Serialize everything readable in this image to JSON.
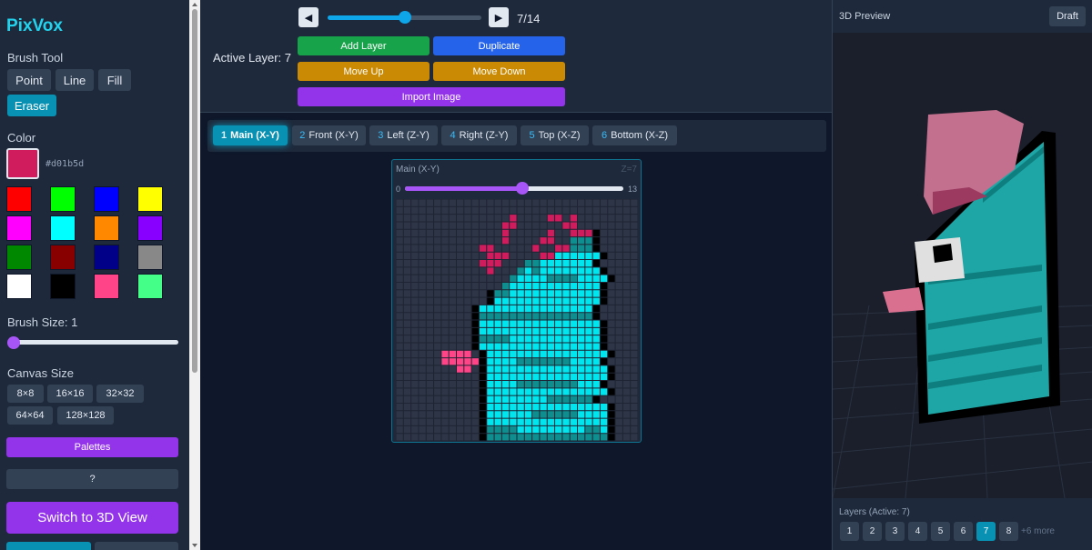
{
  "app": {
    "name": "PixVox"
  },
  "sidebar": {
    "brush_tool_label": "Brush Tool",
    "tools": [
      "Point",
      "Line",
      "Fill",
      "Eraser"
    ],
    "active_tool": "Eraser",
    "color_label": "Color",
    "current_color": "#d01b5d",
    "palette": [
      "#ff0000",
      "#00ff00",
      "#0000ff",
      "#ffff00",
      "#ff00ff",
      "#00ffff",
      "#ff8800",
      "#8800ff",
      "#008800",
      "#880000",
      "#000088",
      "#888888",
      "#ffffff",
      "#000000",
      "#ff4488",
      "#44ff88"
    ],
    "brush_size_label": "Brush Size: 1",
    "brush_size": 1,
    "canvas_size_label": "Canvas Size",
    "canvas_sizes": [
      "8×8",
      "16×16",
      "32×32",
      "64×64",
      "128×128"
    ],
    "palettes_button": "Palettes",
    "help_button": "?",
    "switch_button": "Switch to 3D View"
  },
  "toolbar": {
    "active_layer_label": "Active Layer: 7",
    "prev_icon": "◀",
    "next_icon": "▶",
    "layer_counter": "7/14",
    "layer_slider_value": 7,
    "layer_slider_max": 14,
    "buttons": {
      "add": "Add Layer",
      "duplicate": "Duplicate",
      "up": "Move Up",
      "down": "Move Down",
      "import": "Import Image"
    },
    "colors": {
      "add": "#16a34a",
      "duplicate": "#2563eb",
      "move": "#ca8a04",
      "import": "#9333ea"
    }
  },
  "views": [
    {
      "num": "1",
      "label": "Main (X-Y)",
      "active": true
    },
    {
      "num": "2",
      "label": "Front (X-Y)"
    },
    {
      "num": "3",
      "label": "Left (Z-Y)"
    },
    {
      "num": "4",
      "label": "Right (Z-Y)"
    },
    {
      "num": "5",
      "label": "Top (X-Z)"
    },
    {
      "num": "6",
      "label": "Bottom (X-Z)"
    }
  ],
  "editor": {
    "title": "Main (X-Y)",
    "z_label": "Z=7",
    "slider_min": "0",
    "slider_max": "13",
    "slider_value": 7,
    "grid_size": 32,
    "legend": {
      ".": "empty",
      "p": "pink",
      "t": "teal",
      "c": "cyan",
      "k": "black",
      "r": "rose"
    },
    "colors": {
      "p": "#d01b5d",
      "t": "#0e8e8e",
      "c": "#00e5ee",
      "k": "#000000",
      "r": "#ff4488"
    },
    "grid": [
      "................................",
      "................................",
      "...............p....pp.p........",
      "..............pp......pp........",
      "..............p.....p..pppk.....",
      "..............p....pp..tttk.....",
      "...........pp.....p..pptttk.....",
      "............ppp....ppcccccck.....",
      "...........ppp...ttccccccck.....",
      "............p...tctcccccccck.....",
      "...............tccccttttcccck.....",
      "..............tcccccccccccck.....",
      "............kttcccccccccccck.....",
      "............kcccccccccccccck.....",
      "..........kccccccccccccccck.....",
      "..........ktttttttttttttttk.....",
      "..........kcccccccccccccccck.....",
      "..........kcccccccccccccccck.....",
      "..........kttttcccccccccccck.....",
      "..........kcccccccccccccccck.....",
      "......rrrr.kcccccccccccccccck.....",
      "......rrrrrkcccctttttttcccck.....",
      "........rr.kcccccccccccccccck.....",
      "...........kcccccccccccccccck.....",
      "...........kccccttttttttccck.....",
      "...........kcccccccccccccccck.....",
      "...........kccccccccttttttk.....",
      "...........kcccccccccccccccck.....",
      "...........kccccccttttttcccck.....",
      "...........kcccccccccccccccck.....",
      "...........kttttcccccccccttck.....",
      "...........kttttttttttttttttk....."
    ]
  },
  "preview": {
    "title": "3D Preview",
    "draft_button": "Draft",
    "layers_label": "Layers (Active: 7)",
    "layers": [
      "1",
      "2",
      "3",
      "4",
      "5",
      "6",
      "7",
      "8"
    ],
    "active_layer": "7",
    "more_label": "+6 more"
  }
}
